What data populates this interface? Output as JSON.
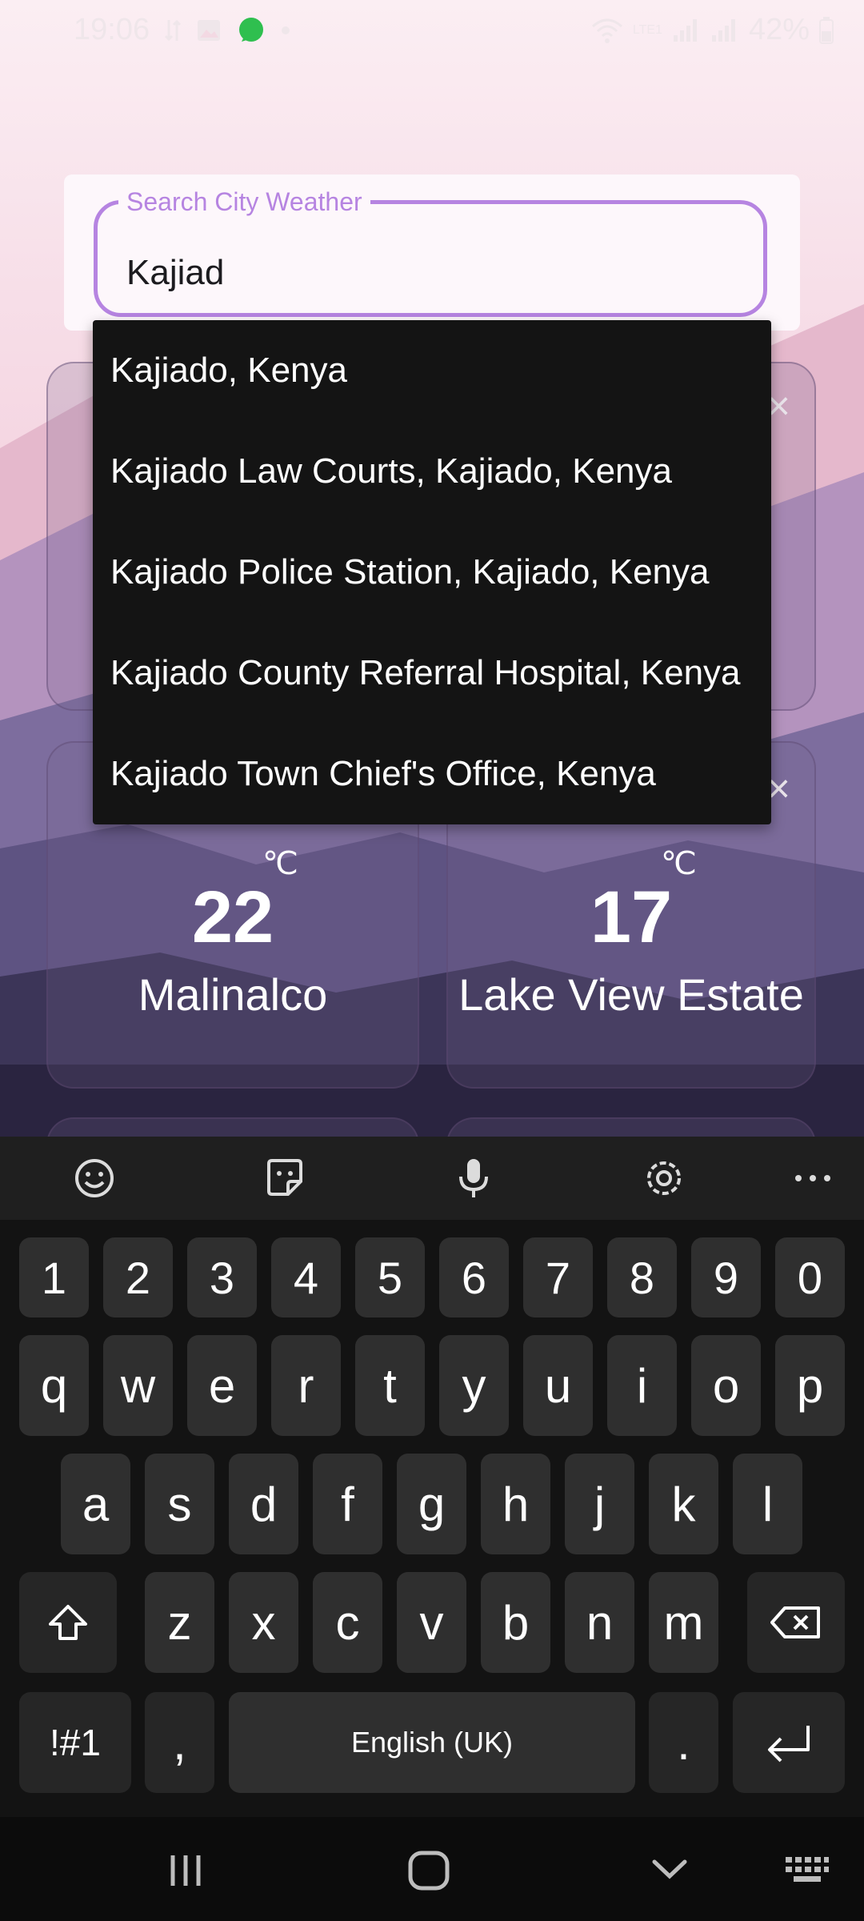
{
  "status_bar": {
    "time": "19:06",
    "network": "LTE1",
    "battery": "42%"
  },
  "search": {
    "label": "Search City Weather",
    "value": "Kajiad"
  },
  "suggestions": [
    "Kajiado, Kenya",
    "Kajiado Law Courts, Kajiado, Kenya",
    "Kajiado Police Station, Kajiado, Kenya",
    "Kajiado County Referral Hospital, Kenya",
    "Kajiado Town Chief's Office, Kenya"
  ],
  "cards": [
    {
      "temp": "22",
      "unit": "℃",
      "city": "Malinalco"
    },
    {
      "temp": "17",
      "unit": "℃",
      "city": "Lake View Estate"
    }
  ],
  "keyboard": {
    "numbers": [
      "1",
      "2",
      "3",
      "4",
      "5",
      "6",
      "7",
      "8",
      "9",
      "0"
    ],
    "row1": [
      "q",
      "w",
      "e",
      "r",
      "t",
      "y",
      "u",
      "i",
      "o",
      "p"
    ],
    "row2": [
      "a",
      "s",
      "d",
      "f",
      "g",
      "h",
      "j",
      "k",
      "l"
    ],
    "row3": [
      "z",
      "x",
      "c",
      "v",
      "b",
      "n",
      "m"
    ],
    "symbols_label": "!#1",
    "comma_label": ",",
    "space_label": "English (UK)",
    "period_label": "."
  },
  "colors": {
    "accent": "#b684e1",
    "dropdown_bg": "#141414",
    "keyboard_bg": "#131313",
    "key_bg": "#2f2f2f"
  }
}
